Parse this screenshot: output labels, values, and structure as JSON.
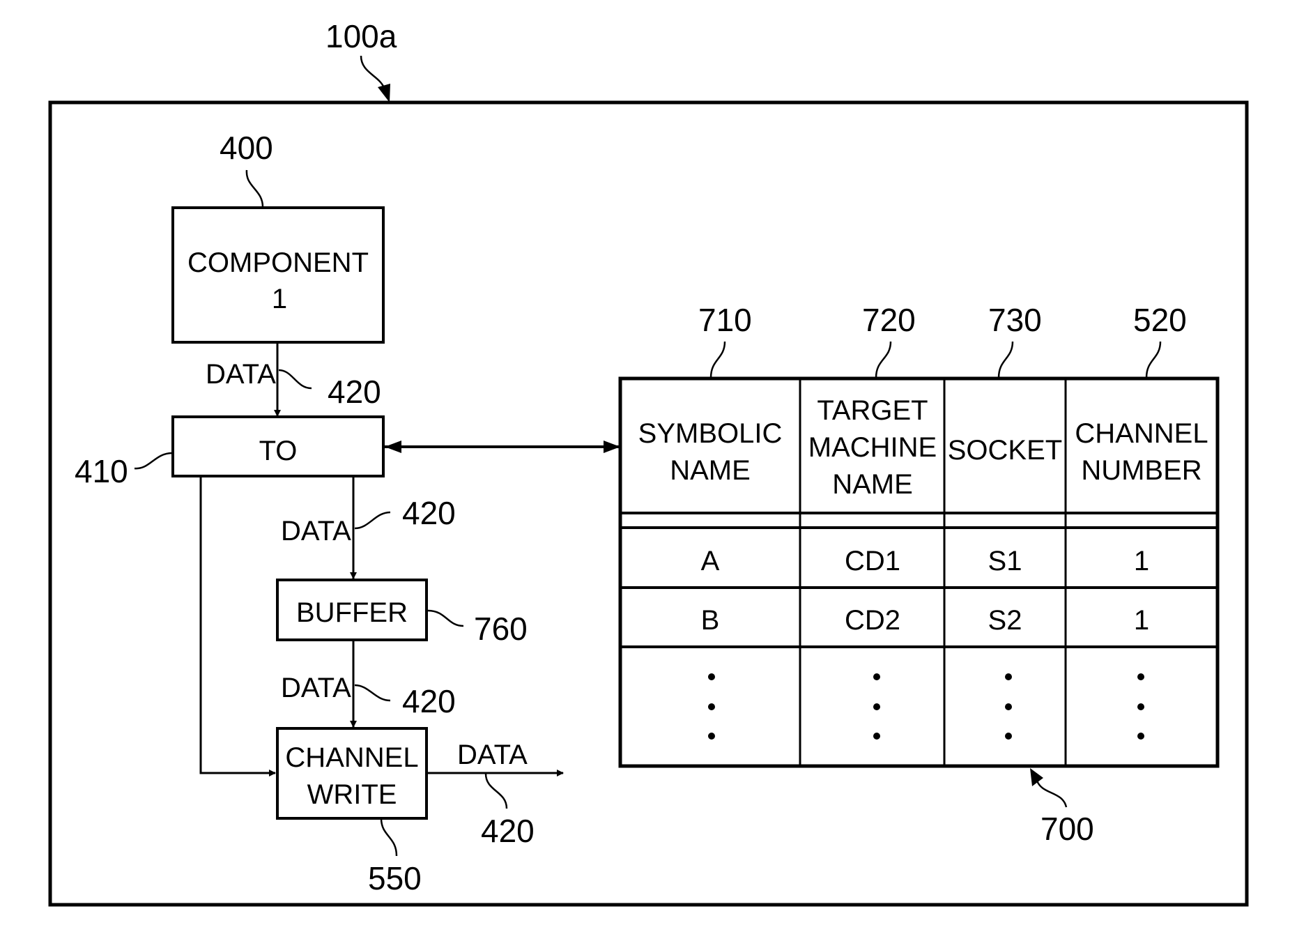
{
  "figure": {
    "reference": "100a"
  },
  "nodes": {
    "component": {
      "ref": "400",
      "lines": [
        "COMPONENT",
        "1"
      ]
    },
    "to": {
      "ref": "410",
      "label": "TO"
    },
    "buffer": {
      "ref": "760",
      "label": "BUFFER"
    },
    "channel_write": {
      "ref": "550",
      "lines": [
        "CHANNEL",
        "WRITE"
      ]
    }
  },
  "edges": {
    "component_to": {
      "label": "DATA",
      "ref": "420"
    },
    "to_buffer": {
      "label": "DATA",
      "ref": "420"
    },
    "buffer_channel_write": {
      "label": "DATA",
      "ref": "420"
    },
    "channel_write_out": {
      "label": "DATA",
      "ref": "420"
    },
    "to_table": {
      "type": "bidirectional"
    },
    "to_channel_write": {
      "type": "bypass"
    }
  },
  "table": {
    "ref": "700",
    "columns": [
      {
        "ref": "710",
        "header_lines": [
          "SYMBOLIC",
          "NAME"
        ]
      },
      {
        "ref": "720",
        "header_lines": [
          "TARGET",
          "MACHINE",
          "NAME"
        ]
      },
      {
        "ref": "730",
        "header_lines": [
          "SOCKET"
        ]
      },
      {
        "ref": "520",
        "header_lines": [
          "CHANNEL",
          "NUMBER"
        ]
      }
    ],
    "rows": [
      [
        "A",
        "CD1",
        "S1",
        "1"
      ],
      [
        "B",
        "CD2",
        "S2",
        "1"
      ]
    ],
    "continuation": "ellipsis-vertical"
  }
}
